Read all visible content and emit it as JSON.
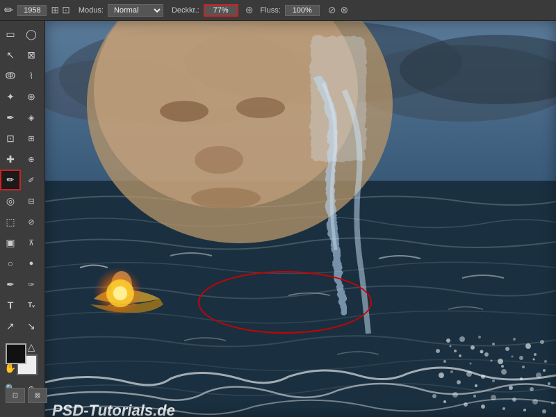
{
  "toolbar": {
    "brush_size": "1958",
    "mode_label": "Modus:",
    "mode_value": "Normal",
    "opacity_label": "Deckkr.:",
    "opacity_value": "77%",
    "flow_label": "Fluss:",
    "flow_value": "100%"
  },
  "tools": [
    {
      "id": "marquee-rect",
      "icon": "▭",
      "active": false
    },
    {
      "id": "marquee-ellipse",
      "icon": "◯",
      "active": false
    },
    {
      "id": "lasso",
      "icon": "⌇",
      "active": false
    },
    {
      "id": "lasso-poly",
      "icon": "⌇",
      "active": false
    },
    {
      "id": "magic-wand",
      "icon": "✦",
      "active": false
    },
    {
      "id": "crop",
      "icon": "⊡",
      "active": false
    },
    {
      "id": "eyedropper",
      "icon": "✒",
      "active": false
    },
    {
      "id": "healing",
      "icon": "✚",
      "active": false
    },
    {
      "id": "brush",
      "icon": "✏",
      "active": true
    },
    {
      "id": "clone-stamp",
      "icon": "◎",
      "active": false
    },
    {
      "id": "eraser",
      "icon": "⬜",
      "active": false
    },
    {
      "id": "gradient",
      "icon": "▣",
      "active": false
    },
    {
      "id": "dodge",
      "icon": "○",
      "active": false
    },
    {
      "id": "pen",
      "icon": "✒",
      "active": false
    },
    {
      "id": "type",
      "icon": "T",
      "active": false
    },
    {
      "id": "shape",
      "icon": "△",
      "active": false
    },
    {
      "id": "select-move",
      "icon": "↖",
      "active": false
    },
    {
      "id": "select-path",
      "icon": "↗",
      "active": false
    },
    {
      "id": "hand",
      "icon": "✋",
      "active": false
    },
    {
      "id": "zoom",
      "icon": "🔍",
      "active": false
    }
  ],
  "canvas": {
    "psd_text": "PSD-Tutorials.de",
    "annotation": "red ellipse marker"
  }
}
